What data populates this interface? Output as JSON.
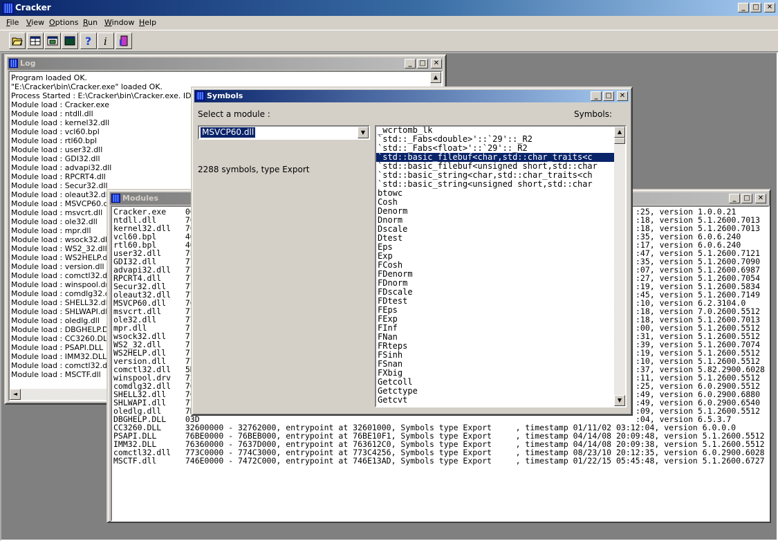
{
  "app": {
    "title": "Cracker"
  },
  "menu": [
    "File",
    "View",
    "Options",
    "Run",
    "Window",
    "Help"
  ],
  "toolbar": [
    "open-folder-icon",
    "grid-view-icon",
    "window-view-icon",
    "console-icon",
    "help-icon",
    "info-icon",
    "exit-icon"
  ],
  "log": {
    "title": "Log",
    "lines": [
      "Program loaded OK.",
      "\"E:\\Cracker\\bin\\Cracker.exe\" loaded OK.",
      "Process Started : E:\\Cracker\\bin\\Cracker.exe. ID=540,",
      "Module load : Cracker.exe",
      "Module load : ntdll.dll",
      "Module load : kernel32.dll",
      "Module load : vcl60.bpl",
      "Module load : rtl60.bpl",
      "Module load : user32.dll",
      "Module load : GDI32.dll",
      "Module load : advapi32.dll",
      "Module load : RPCRT4.dll",
      "Module load : Secur32.dll",
      "Module load : oleaut32.dll",
      "Module load : MSVCP60.dll",
      "Module load : msvcrt.dll",
      "Module load : ole32.dll",
      "Module load : mpr.dll",
      "Module load : wsock32.dll",
      "Module load : WS2_32.dll",
      "Module load : WS2HELP.dll",
      "Module load : version.dll",
      "Module load : comctl32.dll",
      "Module load : winspool.drv",
      "Module load : comdlg32.dll",
      "Module load : SHELL32.dll",
      "Module load : SHLWAPI.dll",
      "Module load : oledlg.dll",
      "Module load : DBGHELP.DLL",
      "Module load : CC3260.DLL",
      "Module load : PSAPI.DLL",
      "Module load : IMM32.DLL",
      "Module load : comctl32.dll",
      "Module load : MSCTF.dll"
    ]
  },
  "modules": {
    "title": "Modules",
    "left": [
      "Cracker.exe    004",
      "ntdll.dll      7C9",
      "kernel32.dll   7C8",
      "vcl60.bpl      400",
      "rtl60.bpl      400",
      "user32.dll     7E4",
      "GDI32.dll      77F",
      "advapi32.dll   77D",
      "RPCRT4.dll     77E",
      "Secur32.dll    77F",
      "oleaut32.dll   771",
      "MSVCP60.dll    760",
      "msvcrt.dll     77C",
      "ole32.dll      774",
      "mpr.dll        71B",
      "wsock32.dll    71A",
      "WS2_32.dll     71A",
      "WS2HELP.dll    71A",
      "version.dll    77C",
      "comctl32.dll   5D0",
      "winspool.drv   72D",
      "comdlg32.dll   763",
      "SHELL32.dll    7C9",
      "SHLWAPI.dll    77F",
      "oledlg.dll     7DF",
      "DBGHELP.DLL    03D",
      "CC3260.DLL     32600000 - 32762000, entrypoint at 32601000, Symbols type Export     , timestamp 01/11/02 03:12:04, version 6.0.0.0",
      "PSAPI.DLL      76BE0000 - 76BEB000, entrypoint at 76BE10F1, Symbols type Export     , timestamp 04/14/08 20:09:48, version 5.1.2600.5512",
      "IMM32.DLL      76360000 - 7637D000, entrypoint at 763612C0, Symbols type Export     , timestamp 04/14/08 20:09:38, version 5.1.2600.5512",
      "comctl32.dll   773C0000 - 774C3000, entrypoint at 773C4256, Symbols type Export     , timestamp 08/23/10 20:12:35, version 6.0.2900.6028",
      "MSCTF.dll      746E0000 - 7472C000, entrypoint at 746E13AD, Symbols type Export     , timestamp 01/22/15 05:45:48, version 5.1.2600.6727"
    ],
    "right": [
      ":25, version 1.0.0.21",
      ":18, version 5.1.2600.7013",
      ":18, version 5.1.2600.7013",
      ":35, version 6.0.6.240",
      ":17, version 6.0.6.240",
      ":47, version 5.1.2600.7121",
      ":35, version 5.1.2600.7090",
      ":07, version 5.1.2600.6987",
      ":27, version 5.1.2600.7054",
      ":19, version 5.1.2600.5834",
      ":45, version 5.1.2600.7149",
      ":10, version 6.2.3104.0",
      ":18, version 7.0.2600.5512",
      ":18, version 5.1.2600.7013",
      ":00, version 5.1.2600.5512",
      ":31, version 5.1.2600.5512",
      ":39, version 5.1.2600.7074",
      ":19, version 5.1.2600.5512",
      ":10, version 5.1.2600.5512",
      ":37, version 5.82.2900.6028",
      ":11, version 5.1.2600.5512",
      ":25, version 6.0.2900.5512",
      ":49, version 6.0.2900.6880",
      ":49, version 6.0.2900.6540",
      ":09, version 5.1.2600.5512",
      ":04, version 6.5.3.7"
    ]
  },
  "symbols": {
    "title": "Symbols",
    "select_label": "Select a module :",
    "symbols_label": "Symbols:",
    "module": "MSVCP60.dll",
    "info": "2288 symbols, type Export",
    "items": [
      "_wcrtomb_lk",
      "`std::_Fabs<double>'::`29'::_R2",
      "`std::_Fabs<float>'::`29'::_R2",
      "`std::basic_filebuf<char,std::char_traits<c",
      "`std::basic_filebuf<unsigned short,std::char",
      "`std::basic_string<char,std::char_traits<ch",
      "`std::basic_string<unsigned short,std::char",
      "btowc",
      "Cosh",
      "Denorm",
      "Dnorm",
      "Dscale",
      "Dtest",
      "Eps",
      "Exp",
      "FCosh",
      "FDenorm",
      "FDnorm",
      "FDscale",
      "FDtest",
      "FEps",
      "FExp",
      "FInf",
      "FNan",
      "FRteps",
      "FSinh",
      "FSnan",
      "FXbig",
      "Getcoll",
      "Getctype",
      "Getcvt"
    ],
    "selected_index": 3
  }
}
